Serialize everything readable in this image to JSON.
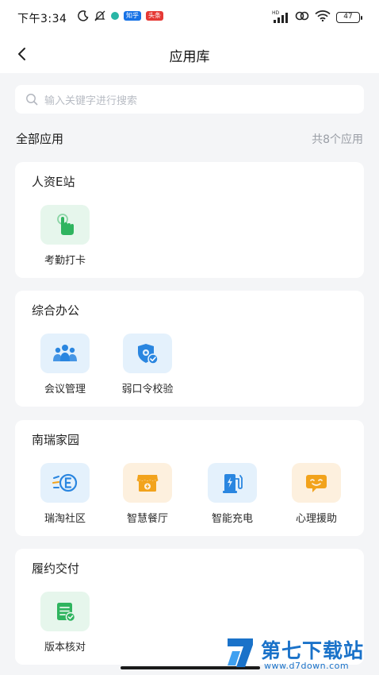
{
  "status_bar": {
    "time": "下午3:34",
    "badge_zhihu": "知乎",
    "badge_toutiao": "头条",
    "signal_label": "HD",
    "battery": "47"
  },
  "nav": {
    "title": "应用库"
  },
  "search": {
    "placeholder": "输入关键字进行搜索"
  },
  "section": {
    "title": "全部应用",
    "count": "共8个应用"
  },
  "groups": [
    {
      "title": "人资E站",
      "apps": [
        {
          "label": "考勤打卡",
          "icon": "hand-tap-icon",
          "color": "#2fb45f"
        }
      ]
    },
    {
      "title": "综合办公",
      "apps": [
        {
          "label": "会议管理",
          "icon": "meeting-people-icon",
          "color": "#2a86e0"
        },
        {
          "label": "弱口令校验",
          "icon": "shield-gear-icon",
          "color": "#2a86e0"
        }
      ]
    },
    {
      "title": "南瑞家园",
      "apps": [
        {
          "label": "瑞淘社区",
          "icon": "community-e-icon",
          "color": "#2a86e0"
        },
        {
          "label": "智慧餐厅",
          "icon": "restaurant-store-icon",
          "color": "#f2a31c"
        },
        {
          "label": "智能充电",
          "icon": "charging-pile-icon",
          "color": "#2a86e0"
        },
        {
          "label": "心理援助",
          "icon": "mental-help-icon",
          "color": "#f2a31c"
        }
      ]
    },
    {
      "title": "履约交付",
      "apps": [
        {
          "label": "版本核对",
          "icon": "document-check-icon",
          "color": "#2fb45f"
        }
      ]
    }
  ],
  "watermark": {
    "title": "第七下载站",
    "url": "www.d7down.com"
  }
}
